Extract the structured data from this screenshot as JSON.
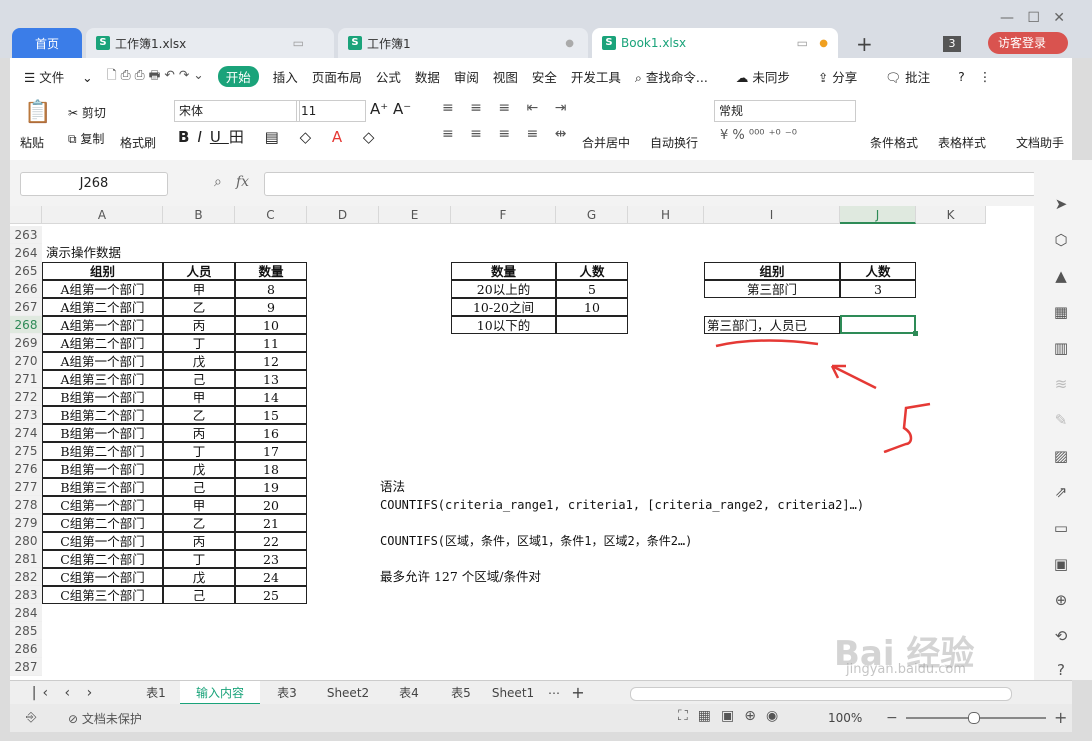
{
  "window": {
    "tab_home": "首页",
    "tabs": [
      "工作簿1.xlsx",
      "工作簿1",
      "Book1.xlsx"
    ],
    "new_tab": "+",
    "count_badge": "3",
    "login": "访客登录"
  },
  "menu": {
    "file": "文件",
    "items": [
      "开始",
      "插入",
      "页面布局",
      "公式",
      "数据",
      "审阅",
      "视图",
      "安全",
      "开发工具"
    ],
    "search": "查找命令...",
    "unsync": "未同步",
    "share": "分享",
    "comment": "批注"
  },
  "ribbon": {
    "paste": "粘贴",
    "cut": "剪切",
    "copy": "复制",
    "format_painter": "格式刷",
    "font": "宋体",
    "size": "11",
    "merge": "合并居中",
    "wrap": "自动换行",
    "numfmt": "常规",
    "cond_format": "条件格式",
    "table_style": "表格样式",
    "doc_helper": "文档助手"
  },
  "formula": {
    "name_box": "J268",
    "fx": "fx",
    "value": ""
  },
  "columns": [
    "A",
    "B",
    "C",
    "D",
    "E",
    "F",
    "G",
    "H",
    "I",
    "J",
    "K"
  ],
  "rows": [
    "263",
    "264",
    "265",
    "266",
    "267",
    "268",
    "269",
    "270",
    "271",
    "272",
    "273",
    "274",
    "275",
    "276",
    "277",
    "278",
    "279",
    "280",
    "281",
    "282",
    "283",
    "284",
    "285",
    "286",
    "287"
  ],
  "title_cell": "演示操作数据",
  "table1": {
    "headers": [
      "组别",
      "人员",
      "数量"
    ],
    "rows": [
      [
        "A组第一个部门",
        "甲",
        "8"
      ],
      [
        "A组第二个部门",
        "乙",
        "9"
      ],
      [
        "A组第一个部门",
        "丙",
        "10"
      ],
      [
        "A组第二个部门",
        "丁",
        "11"
      ],
      [
        "A组第一个部门",
        "戊",
        "12"
      ],
      [
        "A组第三个部门",
        "己",
        "13"
      ],
      [
        "B组第一个部门",
        "甲",
        "14"
      ],
      [
        "B组第二个部门",
        "乙",
        "15"
      ],
      [
        "B组第一个部门",
        "丙",
        "16"
      ],
      [
        "B组第二个部门",
        "丁",
        "17"
      ],
      [
        "B组第一个部门",
        "戊",
        "18"
      ],
      [
        "B组第三个部门",
        "己",
        "19"
      ],
      [
        "C组第一个部门",
        "甲",
        "20"
      ],
      [
        "C组第二个部门",
        "乙",
        "21"
      ],
      [
        "C组第一个部门",
        "丙",
        "22"
      ],
      [
        "C组第二个部门",
        "丁",
        "23"
      ],
      [
        "C组第一个部门",
        "戊",
        "24"
      ],
      [
        "C组第三个部门",
        "己",
        "25"
      ]
    ]
  },
  "table2": {
    "headers": [
      "数量",
      "人数"
    ],
    "rows": [
      [
        "20以上的",
        "5"
      ],
      [
        "10-20之间",
        "10"
      ],
      [
        "10以下的",
        ""
      ]
    ]
  },
  "table3": {
    "headers": [
      "组别",
      "人数"
    ],
    "rows": [
      [
        "第三部门",
        "3"
      ]
    ]
  },
  "i268": "第三部门，人员已",
  "syntax": {
    "title": "语法",
    "line1": "COUNTIFS(criteria_range1, criteria1, [criteria_range2, criteria2]…)",
    "line2": "COUNTIFS(区域，条件，区域1，条件1，区域2，条件2…)",
    "line3": "最多允许 127 个区域/条件对"
  },
  "annotation_number": "5",
  "sheet_tabs": [
    "表1",
    "输入内容",
    "表3",
    "Sheet2",
    "表4",
    "表5",
    "Sheet1"
  ],
  "status": {
    "protect": "文档未保护",
    "zoom": "100%"
  },
  "watermark": {
    "brand": "Bai 经验",
    "url": "jingyan.baidu.com"
  },
  "colors": {
    "accent": "#3b7de8",
    "green": "#1aa37a",
    "red": "#e53935",
    "selected": "#2e8b57"
  }
}
